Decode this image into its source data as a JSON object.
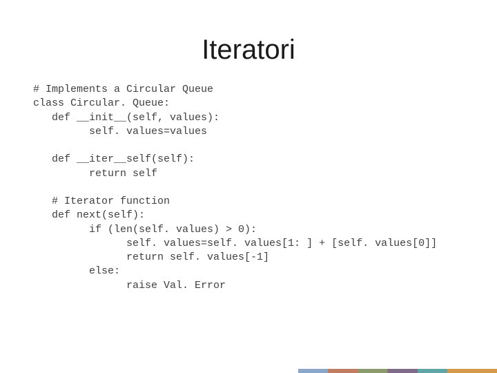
{
  "title": "Iteratori",
  "code": {
    "lines": [
      "# Implements a Circular Queue",
      "class Circular. Queue:",
      "   def __init__(self, values):",
      "         self. values=values",
      "",
      "   def __iter__self(self):",
      "         return self",
      "",
      "   # Iterator function",
      "   def next(self):",
      "         if (len(self. values) > 0):",
      "               self. values=self. values[1: ] + [self. values[0]]",
      "               return self. values[-1]",
      "         else:",
      "               raise Val. Error"
    ]
  }
}
